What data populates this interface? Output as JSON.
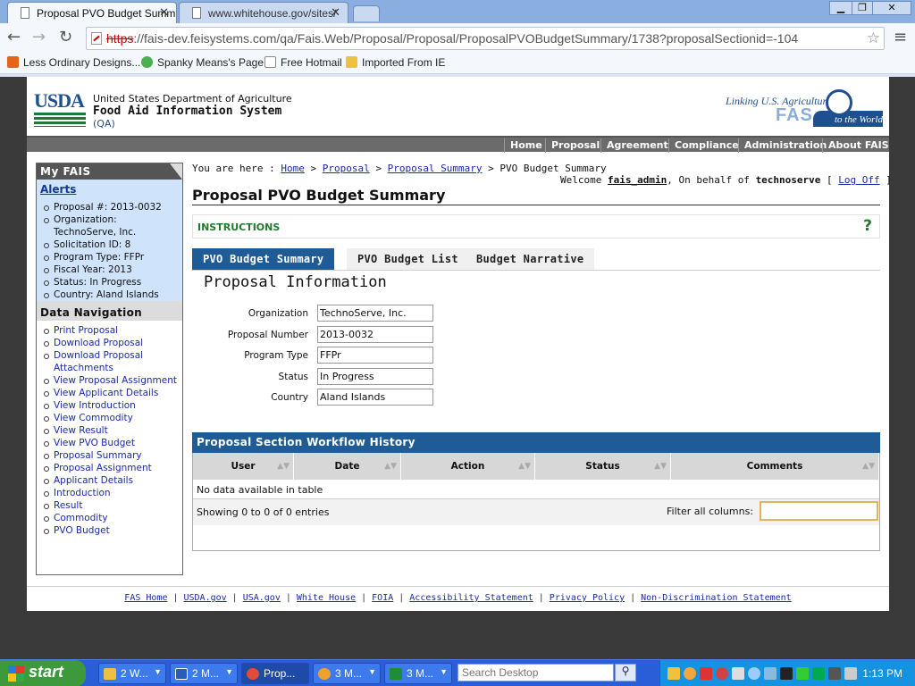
{
  "browser": {
    "tabs": [
      {
        "label": "Proposal PVO Budget Summa",
        "active": true
      },
      {
        "label": "www.whitehouse.gov/sites/",
        "active": false
      }
    ],
    "url_scheme": "https",
    "url_rest": "://fais-dev.feisystems.com/qa/Fais.Web/Proposal/Proposal/ProposalPVOBudgetSummary/1738?proposalSectionid=-104",
    "bookmarks": [
      {
        "label": "Less Ordinary Designs...",
        "color": "#e8631a"
      },
      {
        "label": "Spanky Means's Page",
        "color": "#4caf50"
      },
      {
        "label": "Free Hotmail",
        "color": "#ffffff"
      },
      {
        "label": "Imported From IE",
        "color": "#f0c040"
      }
    ]
  },
  "header": {
    "logo_text": "USDA",
    "dept": "United States Department of Agriculture",
    "system": "Food Aid Information System",
    "env": "(QA)",
    "fas_tagline": "Linking U.S. Agriculture",
    "fas_name": "FAS",
    "fas_world": "to the World"
  },
  "topnav": [
    "Home",
    "Proposal",
    "Agreement",
    "Compliance",
    "Administration",
    "About FAIS"
  ],
  "sidebar": {
    "heading": "My FAIS",
    "alerts_title": "Alerts",
    "alerts": [
      "Proposal #: 2013-0032",
      "Organization: TechnoServe, Inc.",
      "Solicitation ID: 8",
      "Program Type: FFPr",
      "Fiscal Year: 2013",
      "Status: In Progress",
      "Country: Aland Islands"
    ],
    "data_nav_title": "Data Navigation",
    "data_nav": [
      "Print Proposal",
      "Download Proposal",
      "Download Proposal Attachments",
      "View Proposal Assignment",
      "View Applicant Details",
      "View Introduction",
      "View Commodity",
      "View Result",
      "View PVO Budget",
      "Proposal Summary",
      "Proposal Assignment",
      "Applicant Details",
      "Introduction",
      "Result",
      "Commodity",
      "PVO Budget"
    ]
  },
  "breadcrumb": {
    "prefix": "You are here :",
    "items": [
      "Home",
      "Proposal",
      "Proposal Summary"
    ],
    "current": "PVO Budget Summary",
    "sep": ">"
  },
  "welcome": {
    "prefix": "Welcome",
    "user": "fais_admin",
    "behalf_text": ", On behalf of",
    "org": "technoserve",
    "logoff": "Log Off"
  },
  "page_title": "Proposal PVO Budget Summary",
  "instructions": {
    "label": "INSTRUCTIONS",
    "help": "?"
  },
  "tabs": [
    "PVO Budget Summary",
    "PVO Budget List",
    "Budget Narrative"
  ],
  "section_title": "Proposal Information",
  "fields": [
    {
      "label": "Organization",
      "value": "TechnoServe, Inc."
    },
    {
      "label": "Proposal Number",
      "value": "2013-0032"
    },
    {
      "label": "Program Type",
      "value": "FFPr"
    },
    {
      "label": "Status",
      "value": "In Progress"
    },
    {
      "label": "Country",
      "value": "Aland Islands"
    }
  ],
  "workflow": {
    "title": "Proposal Section Workflow History",
    "columns": [
      "User",
      "Date",
      "Action",
      "Status",
      "Comments"
    ],
    "empty": "No data available in table",
    "showing": "Showing 0 to 0 of 0 entries",
    "filter_label": "Filter all columns:",
    "filter_value": ""
  },
  "footer": [
    "FAS Home",
    "USDA.gov",
    "USA.gov",
    "White House",
    "FOIA",
    "Accessibility Statement",
    "Privacy Policy",
    "Non-Discrimination Statement"
  ],
  "taskbar": {
    "start": "start",
    "items": [
      {
        "label": "2 W...",
        "color": "#f0c040"
      },
      {
        "label": "2 M...",
        "color": "#2a5cbb"
      },
      {
        "label": "Prop...",
        "color": "#e04b3a"
      },
      {
        "label": "3 M...",
        "color": "#f0a030"
      },
      {
        "label": "3 M...",
        "color": "#1f8c3a"
      }
    ],
    "search_placeholder": "Search Desktop",
    "clock": "1:13 PM"
  }
}
